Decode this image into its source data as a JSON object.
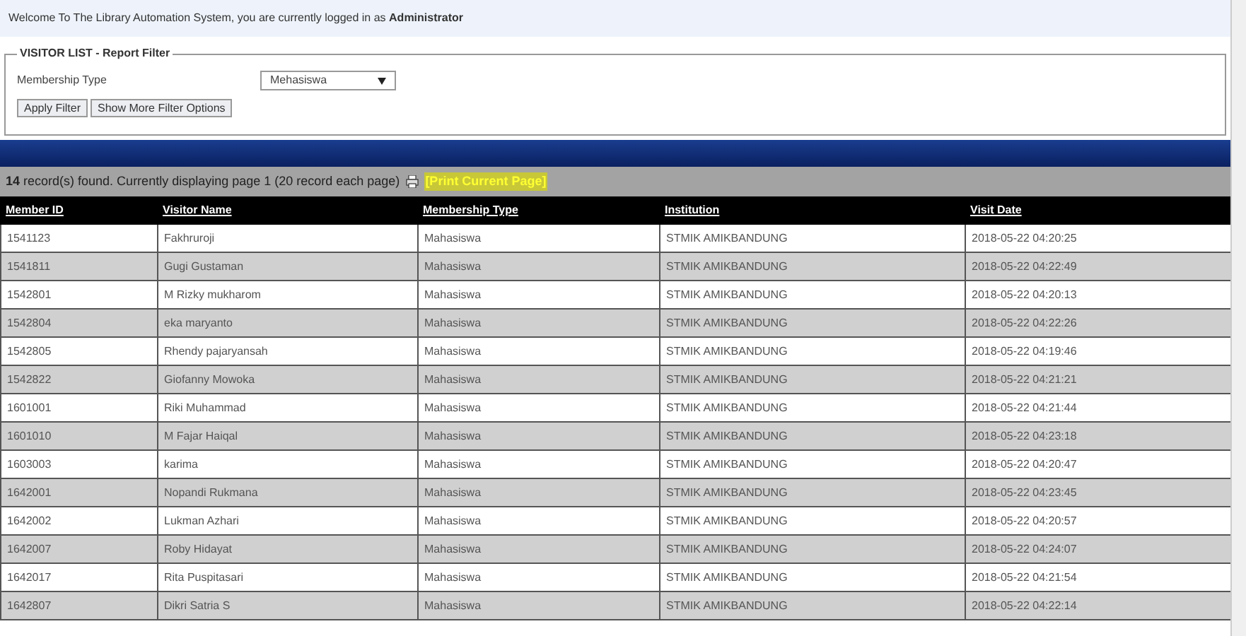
{
  "welcome": "Welcome To The Library Automation System, you are currently logged in as **Administrator**",
  "filter": {
    "legend": "VISITOR LIST - Report Filter",
    "field_label": "Membership Type",
    "select_value": "Mehasiswa",
    "buttons": [
      "Apply Filter",
      "Show More Filter Options"
    ]
  },
  "summary": {
    "count": "14",
    "text": "record(s) found. Currently displaying page 1 (20 record each page)",
    "print_link": "[Print Current Page]"
  },
  "table": {
    "columns": [
      "Member ID",
      "Visitor Name",
      "Membership Type",
      "Institution",
      "Visit Date"
    ],
    "rows": [
      [
        "1541123",
        "Fakhruroji",
        "Mahasiswa",
        "STMIK AMIKBANDUNG",
        "2018-05-22 04:20:25"
      ],
      [
        "1541811",
        "Gugi Gustaman",
        "Mahasiswa",
        "STMIK AMIKBANDUNG",
        "2018-05-22 04:22:49"
      ],
      [
        "1542801",
        "M Rizky mukharom",
        "Mahasiswa",
        "STMIK AMIKBANDUNG",
        "2018-05-22 04:20:13"
      ],
      [
        "1542804",
        "eka maryanto",
        "Mahasiswa",
        "STMIK AMIKBANDUNG",
        "2018-05-22 04:22:26"
      ],
      [
        "1542805",
        "Rhendy pajaryansah",
        "Mahasiswa",
        "STMIK AMIKBANDUNG",
        "2018-05-22 04:19:46"
      ],
      [
        "1542822",
        "Giofanny Mowoka",
        "Mahasiswa",
        "STMIK AMIKBANDUNG",
        "2018-05-22 04:21:21"
      ],
      [
        "1601001",
        "Riki Muhammad",
        "Mahasiswa",
        "STMIK AMIKBANDUNG",
        "2018-05-22 04:21:44"
      ],
      [
        "1601010",
        "M Fajar Haiqal",
        "Mahasiswa",
        "STMIK AMIKBANDUNG",
        "2018-05-22 04:23:18"
      ],
      [
        "1603003",
        "karima",
        "Mahasiswa",
        "STMIK AMIKBANDUNG",
        "2018-05-22 04:20:47"
      ],
      [
        "1642001",
        "Nopandi Rukmana",
        "Mahasiswa",
        "STMIK AMIKBANDUNG",
        "2018-05-22 04:23:45"
      ],
      [
        "1642002",
        "Lukman Azhari",
        "Mahasiswa",
        "STMIK AMIKBANDUNG",
        "2018-05-22 04:20:57"
      ],
      [
        "1642007",
        "Roby Hidayat",
        "Mahasiswa",
        "STMIK AMIKBANDUNG",
        "2018-05-22 04:24:07"
      ],
      [
        "1642017",
        "Rita Puspitasari",
        "Mahasiswa",
        "STMIK AMIKBANDUNG",
        "2018-05-22 04:21:54"
      ],
      [
        "1642807",
        "Dikri Satria S",
        "Mahasiswa",
        "STMIK AMIKBANDUNG",
        "2018-05-22 04:22:14"
      ]
    ]
  }
}
